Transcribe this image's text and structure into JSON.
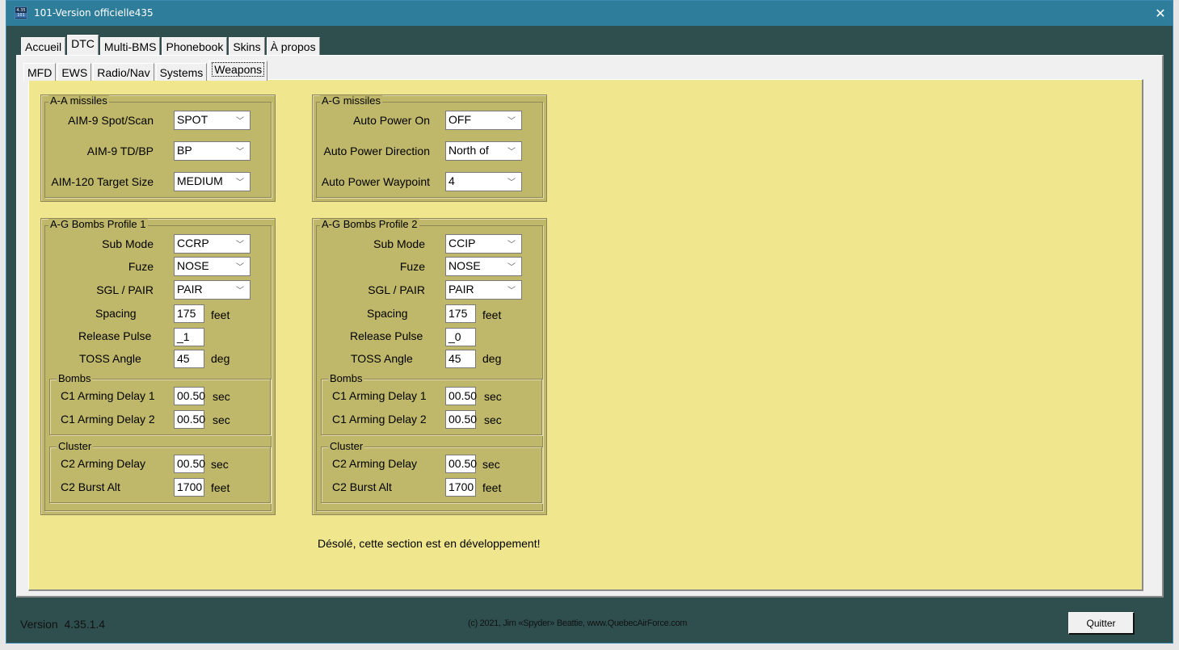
{
  "window": {
    "title": "101-Version officielle435",
    "icon_top": "4.35",
    "icon_bottom": "101",
    "close_icon": "close-icon"
  },
  "main_tabs": [
    {
      "label": "Accueil",
      "active": false
    },
    {
      "label": "DTC",
      "active": true
    },
    {
      "label": "Multi-BMS",
      "active": false
    },
    {
      "label": "Phonebook",
      "active": false
    },
    {
      "label": "Skins",
      "active": false
    },
    {
      "label": "À propos",
      "active": false
    }
  ],
  "sub_tabs": [
    {
      "label": "MFD",
      "active": false
    },
    {
      "label": "EWS",
      "active": false
    },
    {
      "label": "Radio/Nav",
      "active": false
    },
    {
      "label": "Systems",
      "active": false
    },
    {
      "label": "Weapons",
      "active": true
    }
  ],
  "aa_missiles": {
    "title": "A-A missiles",
    "fields": [
      {
        "label": "AIM-9 Spot/Scan",
        "value": "SPOT"
      },
      {
        "label": "AIM-9 TD/BP",
        "value": "BP"
      },
      {
        "label": "AIM-120 Target Size",
        "value": "MEDIUM"
      }
    ]
  },
  "ag_missiles": {
    "title": "A-G missiles",
    "fields": [
      {
        "label": "Auto Power On",
        "value": "OFF"
      },
      {
        "label": "Auto Power Direction",
        "value": "North of"
      },
      {
        "label": "Auto Power Waypoint",
        "value": "4"
      }
    ]
  },
  "profiles": [
    {
      "title": "A-G Bombs Profile 1",
      "sub_mode": {
        "label": "Sub Mode",
        "value": "CCRP"
      },
      "fuze": {
        "label": "Fuze",
        "value": "NOSE"
      },
      "sgl_pair": {
        "label": "SGL / PAIR",
        "value": "PAIR"
      },
      "spacing": {
        "label": "Spacing",
        "value": "175",
        "unit": "feet"
      },
      "release_pulse": {
        "label": "Release Pulse",
        "value": "_1"
      },
      "toss_angle": {
        "label": "TOSS Angle",
        "value": "45",
        "unit": "deg"
      },
      "bombs": {
        "title": "Bombs",
        "c1_delay1": {
          "label": "C1 Arming Delay 1",
          "value": "00.50",
          "unit": "sec"
        },
        "c1_delay2": {
          "label": "C1 Arming Delay 2",
          "value": "00.50",
          "unit": "sec"
        }
      },
      "cluster": {
        "title": "Cluster",
        "c2_delay": {
          "label": "C2 Arming Delay",
          "value": "00.50",
          "unit": "sec"
        },
        "c2_burst": {
          "label": "C2 Burst Alt",
          "value": "1700",
          "unit": "feet"
        }
      }
    },
    {
      "title": "A-G Bombs Profile 2",
      "sub_mode": {
        "label": "Sub Mode",
        "value": "CCIP"
      },
      "fuze": {
        "label": "Fuze",
        "value": "NOSE"
      },
      "sgl_pair": {
        "label": "SGL / PAIR",
        "value": "PAIR"
      },
      "spacing": {
        "label": "Spacing",
        "value": "175",
        "unit": "feet"
      },
      "release_pulse": {
        "label": "Release Pulse",
        "value": "_0"
      },
      "toss_angle": {
        "label": "TOSS Angle",
        "value": "45",
        "unit": "deg"
      },
      "bombs": {
        "title": "Bombs",
        "c1_delay1": {
          "label": "C1 Arming Delay 1",
          "value": "00.50",
          "unit": "sec"
        },
        "c1_delay2": {
          "label": "C1 Arming Delay 2",
          "value": "00.50",
          "unit": "sec"
        }
      },
      "cluster": {
        "title": "Cluster",
        "c2_delay": {
          "label": "C2 Arming Delay",
          "value": "00.50",
          "unit": "sec"
        },
        "c2_burst": {
          "label": "C2 Burst Alt",
          "value": "1700",
          "unit": "feet"
        }
      }
    }
  ],
  "dev_message": "Désolé, cette section est en développement!",
  "footer": {
    "version": "Version  4.35.1.4",
    "copyright": "(c) 2021, Jim «Spyder» Beattie, www.QuebecAirForce.com",
    "quit_label": "Quitter"
  },
  "colors": {
    "window_bg": "#2f4f4f",
    "titlebar": "#2e7d9a",
    "panel_yellow": "#efe68d",
    "group_olive": "#bfb76a"
  }
}
